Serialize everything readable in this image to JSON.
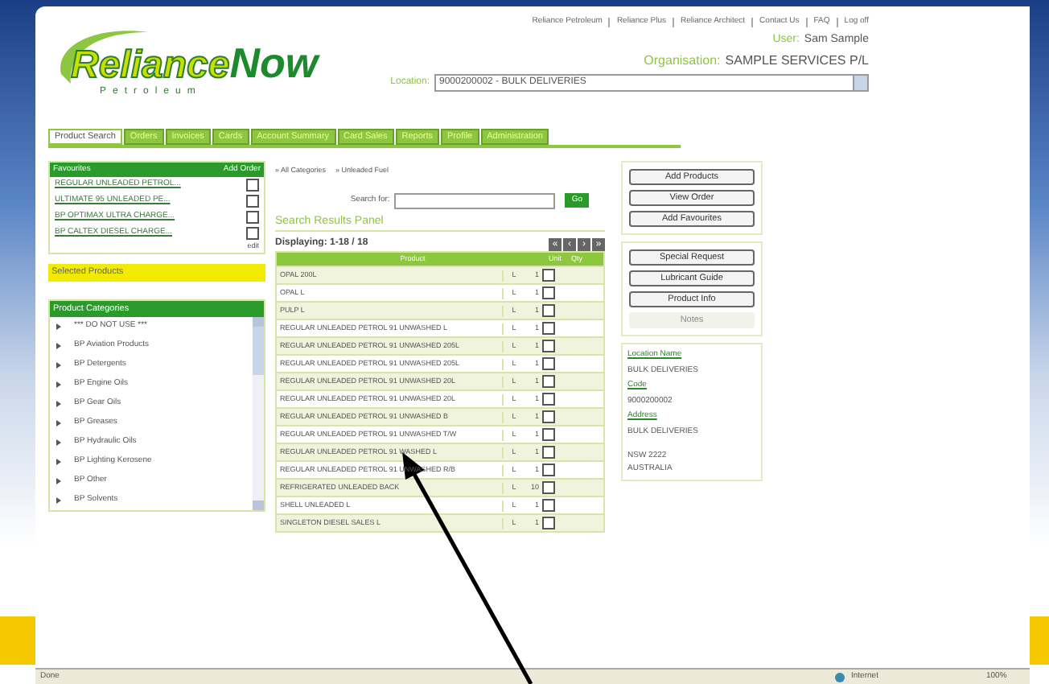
{
  "logo": {
    "brand": "Reliance",
    "brand_suffix": "Now",
    "tagline": "Petroleum"
  },
  "top_links": [
    "Reliance Petroleum",
    "Reliance Plus",
    "Reliance Architect",
    "Contact Us",
    "FAQ",
    "Log off"
  ],
  "user": {
    "label": "User:",
    "value": "Sam Sample"
  },
  "organisation": {
    "label": "Organisation:",
    "value": "SAMPLE SERVICES P/L"
  },
  "location": {
    "label": "Location:",
    "value": "9000200002 - BULK DELIVERIES"
  },
  "tabs": [
    {
      "label": "Product Search",
      "selected": true
    },
    {
      "label": "Orders",
      "selected": false
    },
    {
      "label": "Invoices",
      "selected": false
    },
    {
      "label": "Cards",
      "selected": false
    },
    {
      "label": "Account Summary",
      "selected": false
    },
    {
      "label": "Card Sales",
      "selected": false
    },
    {
      "label": "Reports",
      "selected": false
    },
    {
      "label": "Profile",
      "selected": false
    },
    {
      "label": "Administration",
      "selected": false
    }
  ],
  "favourites": {
    "title": "Favourites",
    "action": "Add Order",
    "edit": "edit",
    "items": [
      {
        "label": "REGULAR UNLEADED PETROL...",
        "checked": false
      },
      {
        "label": "ULTIMATE 95 UNLEADED PE...",
        "checked": false
      },
      {
        "label": "BP OPTIMAX ULTRA CHARGE...",
        "checked": false
      },
      {
        "label": "BP CALTEX DIESEL CHARGE...",
        "checked": false
      }
    ]
  },
  "selected_products": {
    "title": "Selected Products"
  },
  "categories": {
    "title": "Product Categories",
    "items": [
      "*** DO NOT USE ***",
      "BP Aviation Products",
      "BP Detergents",
      "BP Engine Oils",
      "BP Gear Oils",
      "BP Greases",
      "BP Hydraulic Oils",
      "BP Lighting Kerosene",
      "BP Other",
      "BP Solvents"
    ]
  },
  "breadcrumb": [
    "» All Categories",
    "» Unleaded Fuel"
  ],
  "search": {
    "label": "Search for:",
    "button": "Go"
  },
  "results": {
    "title": "Search Results Panel",
    "displaying": "Displaying: 1-18 / 18",
    "nav": [
      "«",
      "‹",
      "›",
      "»"
    ],
    "columns": [
      "Product",
      "Unit",
      "Qty"
    ],
    "rows": [
      {
        "product": "OPAL 200L",
        "unit": "L",
        "qty": "1",
        "checked": false
      },
      {
        "product": "OPAL L",
        "unit": "L",
        "qty": "1",
        "checked": false
      },
      {
        "product": "PULP L",
        "unit": "L",
        "qty": "1",
        "checked": false
      },
      {
        "product": "REGULAR UNLEADED PETROL 91 UNWASHED L",
        "unit": "L",
        "qty": "1",
        "checked": false
      },
      {
        "product": "REGULAR UNLEADED PETROL 91 UNWASHED 205L",
        "unit": "L",
        "qty": "1",
        "checked": false
      },
      {
        "product": "REGULAR UNLEADED PETROL 91 UNWASHED 205L",
        "unit": "L",
        "qty": "1",
        "checked": false
      },
      {
        "product": "REGULAR UNLEADED PETROL 91 UNWASHED 20L",
        "unit": "L",
        "qty": "1",
        "checked": false
      },
      {
        "product": "REGULAR UNLEADED PETROL 91 UNWASHED 20L ",
        "unit": "L",
        "qty": "1",
        "checked": false
      },
      {
        "product": "REGULAR UNLEADED PETROL 91 UNWASHED B",
        "unit": "L",
        "qty": "1",
        "checked": false
      },
      {
        "product": "REGULAR UNLEADED PETROL 91 UNWASHED T/W",
        "unit": "L",
        "qty": "1",
        "checked": false
      },
      {
        "product": "REGULAR UNLEADED PETROL 91 WASHED L",
        "unit": "L",
        "qty": "1",
        "checked": false
      },
      {
        "product": "REGULAR UNLEADED PETROL 91 UNWASHED R/B",
        "unit": "L",
        "qty": "1",
        "checked": false
      },
      {
        "product": "REFRIGERATED UNLEADED BACK",
        "unit": "L",
        "qty": "10",
        "checked": false
      },
      {
        "product": "SHELL UNLEADED L",
        "unit": "L",
        "qty": "1",
        "checked": false
      },
      {
        "product": "SINGLETON DIESEL SALES L",
        "unit": "L",
        "qty": "1",
        "checked": false
      }
    ]
  },
  "actions_1": [
    {
      "label": "Add Products",
      "disabled": false
    },
    {
      "label": "View Order",
      "disabled": false
    },
    {
      "label": "Add Favourites",
      "disabled": false
    }
  ],
  "actions_2": [
    {
      "label": "Special Request",
      "disabled": false
    },
    {
      "label": "Lubricant Guide",
      "disabled": false
    },
    {
      "label": "Product Info",
      "disabled": false
    },
    {
      "label": "Notes",
      "disabled": true
    }
  ],
  "location_info": [
    {
      "label": "Location Name",
      "value": "BULK DELIVERIES"
    },
    {
      "label": "Code",
      "value": "9000200002"
    },
    {
      "label": "Address",
      "value": "BULK DELIVERIES"
    }
  ],
  "address_extra": [
    "NSW 2222",
    "AUSTRALIA"
  ],
  "status_bar": {
    "text": "Done",
    "zone": "Internet",
    "zoom": "100%"
  }
}
